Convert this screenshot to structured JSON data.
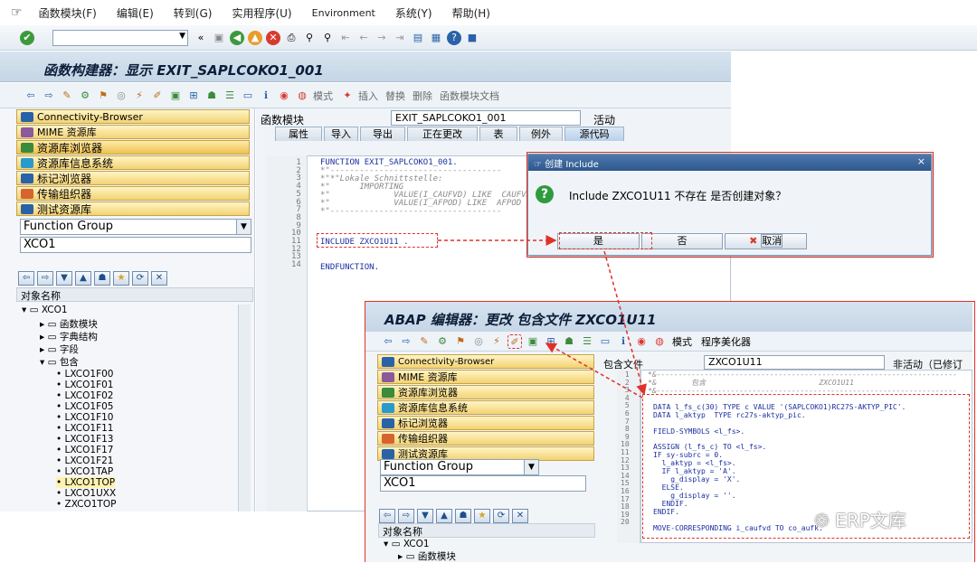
{
  "menubar": {
    "items": [
      "函数模块(F)",
      "编辑(E)",
      "转到(G)",
      "实用程序(U)",
      "Environment",
      "系统(Y)",
      "帮助(H)"
    ]
  },
  "window1": {
    "title": "函数构建器：显示 EXIT_SAPLCOKO1_001",
    "toolbar_labels": [
      "模式",
      "插入",
      "替换",
      "删除",
      "函数模块文档"
    ],
    "left_buttons": [
      "Connectivity-Browser",
      "MIME 资源库",
      "资源库浏览器",
      "资源库信息系统",
      "标记浏览器",
      "传输组织器",
      "测试资源库"
    ],
    "combo_value": "Function Group",
    "combo_input": "XCO1",
    "tree_header": "对象名称",
    "tree_root": "XCO1",
    "tree_folders": [
      "函数模块",
      "字典结构",
      "字段",
      "包含"
    ],
    "tree_includes": [
      "LXCO1F00",
      "LXCO1F01",
      "LXCO1F02",
      "LXCO1F05",
      "LXCO1F10",
      "LXCO1F11",
      "LXCO1F13",
      "LXCO1F17",
      "LXCO1F21",
      "LXCO1TAP",
      "LXCO1TOP",
      "LXCO1UXX",
      "ZXCO1TOP"
    ],
    "fm_label": "函数模块",
    "fm_value": "EXIT_SAPLCOKO1_001",
    "fm_status": "活动",
    "tabs": [
      "属性",
      "导入",
      "导出",
      "正在更改",
      "表",
      "例外",
      "源代码"
    ],
    "code_lines": [
      "FUNCTION EXIT_SAPLCOKO1_001.",
      "*\"-----------------------------------",
      "*\"*\"Lokale Schnittstelle:",
      "*\"      IMPORTING",
      "*\"             VALUE(I_CAUFVD) LIKE  CAUFVD",
      "*\"             VALUE(I_AFPOD) LIKE  AFPOD",
      "*\"-----------------------------------",
      "",
      "",
      "INCLUDE ZXCO1U11 .",
      "",
      "",
      "ENDFUNCTION.",
      ""
    ]
  },
  "dialog": {
    "title": "创建 Include",
    "message": "Include ZXCO1U11 不存在 是否创建对象？",
    "yes": "是",
    "no": "否",
    "cancel": "取消"
  },
  "window2": {
    "title": "ABAP 编辑器：更改 包含文件 ZXCO1U11",
    "toolbar_labels": [
      "模式",
      "程序美化器"
    ],
    "include_label": "包含文件",
    "include_value": "ZXCO1U11",
    "include_status": "非活动（已修订",
    "combo_value": "Function Group",
    "combo_input": "XCO1",
    "tree_header": "对象名称",
    "tree_root": "XCO1",
    "tree_child": "函数模块",
    "code_lines": [
      "*&---------------------------------------------------------------------",
      "*&        包含                          ZXCO1U11",
      "*&---------------------------------------------------------------------",
      "",
      "DATA l_fs_c(30) TYPE c VALUE '(SAPLCOKO1)RC27S-AKTYP_PIC'.",
      "DATA l_aktyp  TYPE rc27s-aktyp_pic.",
      "",
      "FIELD-SYMBOLS <l_fs>.",
      "",
      "ASSIGN (l_fs_c) TO <l_fs>.",
      "IF sy-subrc = 0.",
      "  l_aktyp = <l_fs>.",
      "  IF l_aktyp = 'A'.",
      "    g_display = 'X'.",
      "  ELSE.",
      "    g_display = ''.",
      "  ENDIF.",
      "ENDIF.",
      "",
      "MOVE-CORRESPONDING i_caufvd TO co_aufk."
    ]
  },
  "watermark": "ERP文库"
}
